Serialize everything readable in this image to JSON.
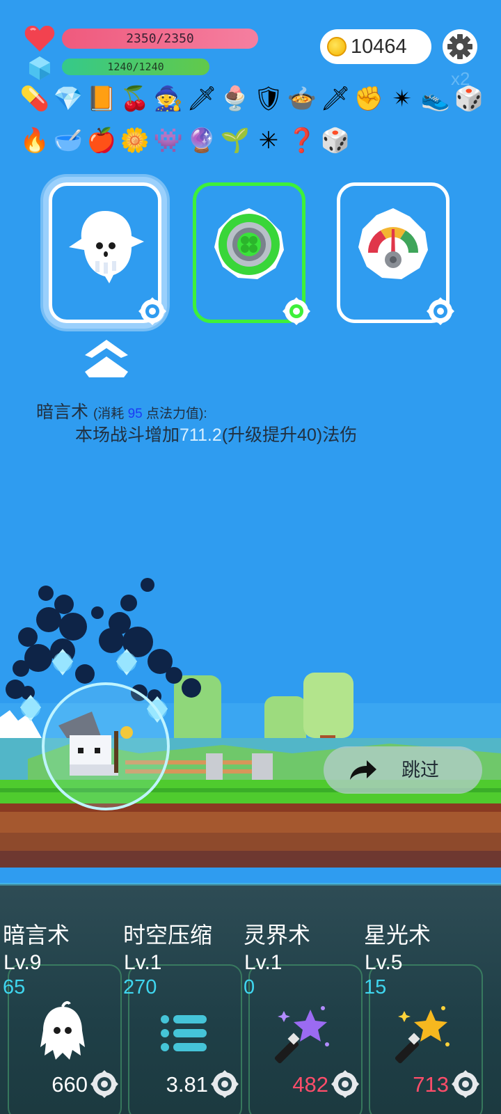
{
  "hud": {
    "hp_text": "2350/2350",
    "mp_text": "1240/1240",
    "coins": "10464",
    "speed": "x2"
  },
  "items": {
    "row1": [
      "pill",
      "crystal",
      "spellbook",
      "cherries",
      "wizard-hat",
      "sword",
      "ice-cream",
      "shield",
      "cauldron",
      "dagger",
      "fist",
      "spiked-ball",
      "sneaker",
      "dice"
    ],
    "row2": [
      "torch",
      "mortar",
      "apple",
      "flower",
      "zombie",
      "crystal-ball",
      "sapling",
      "spiked-mace",
      "hook",
      "dice"
    ],
    "glyphs": {
      "pill": "💊",
      "crystal": "💎",
      "spellbook": "📙",
      "cherries": "🍒",
      "wizard-hat": "🧙",
      "sword": "🗡",
      "ice-cream": "🍨",
      "shield": "🛡",
      "cauldron": "🍲",
      "dagger": "🗡",
      "fist": "✊",
      "spiked-ball": "✴",
      "sneaker": "👟",
      "dice": "🎲",
      "torch": "🔥",
      "mortar": "🥣",
      "apple": "🍎",
      "flower": "🌼",
      "zombie": "👾",
      "crystal-ball": "🔮",
      "sapling": "🌱",
      "spiked-mace": "✳",
      "hook": "❓"
    }
  },
  "skill_cards": [
    {
      "icon": "ghost-icon",
      "selected": true
    },
    {
      "icon": "clover-vortex-icon",
      "selected": false
    },
    {
      "icon": "gauge-icon",
      "selected": false
    }
  ],
  "description": {
    "name": "暗言术",
    "cost_prefix": "(消耗 ",
    "cost": "95",
    "cost_suffix": " 点法力值):",
    "line2_prefix": "本场战斗增加",
    "line2_value": "711.2",
    "line2_suffix": "(升级提升40)法伤"
  },
  "skip_label": "跳过",
  "slots": [
    {
      "name": "暗言术",
      "level": "Lv.9",
      "cost": "65",
      "value": "660",
      "value_color": "white",
      "icon": "ghost-icon"
    },
    {
      "name": "时空压缩",
      "level": "Lv.1",
      "cost": "270",
      "value": "3.81",
      "value_color": "white",
      "icon": "list-icon"
    },
    {
      "name": "灵界术",
      "level": "Lv.1",
      "cost": "0",
      "value": "482",
      "value_color": "red",
      "icon": "purple-star-wand-icon"
    },
    {
      "name": "星光术",
      "level": "Lv.5",
      "cost": "15",
      "value": "713",
      "value_color": "red",
      "icon": "gold-star-wand-icon"
    }
  ],
  "colors": {
    "sky": "#2f9cf0",
    "hp": "#ef5a7d",
    "mp": "#35c98a",
    "selected_green": "#3ef03a",
    "cost_cyan": "#3fd6ef",
    "value_red": "#ff4d6a"
  }
}
